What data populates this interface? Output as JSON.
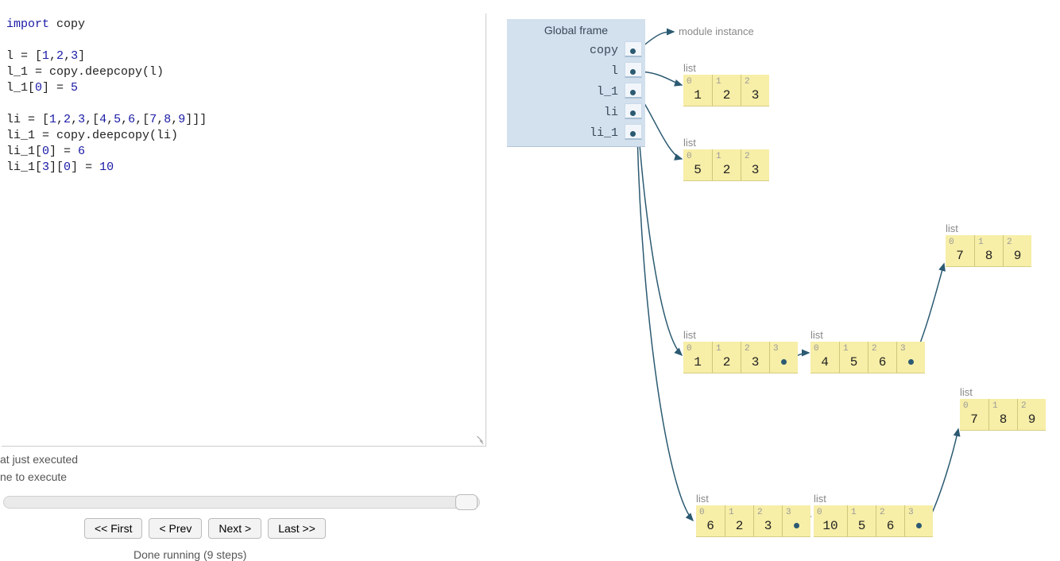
{
  "status": {
    "line1": "at just executed",
    "line2": "ne to execute"
  },
  "buttons": {
    "first": "<< First",
    "prev": "< Prev",
    "next": "Next >",
    "last": "Last >>"
  },
  "done_label": "Done running (9 steps)",
  "code_tokens": [
    {
      "t": "import",
      "c": "kw"
    },
    {
      "t": " copy\n\n",
      "c": ""
    },
    {
      "t": "l = [",
      "c": ""
    },
    {
      "t": "1",
      "c": "num"
    },
    {
      "t": ",",
      "c": ""
    },
    {
      "t": "2",
      "c": "num"
    },
    {
      "t": ",",
      "c": ""
    },
    {
      "t": "3",
      "c": "num"
    },
    {
      "t": "]\n",
      "c": ""
    },
    {
      "t": "l_1 = copy.deepcopy(l)\n",
      "c": ""
    },
    {
      "t": "l_1[",
      "c": ""
    },
    {
      "t": "0",
      "c": "num"
    },
    {
      "t": "] = ",
      "c": ""
    },
    {
      "t": "5",
      "c": "num"
    },
    {
      "t": "\n\n",
      "c": ""
    },
    {
      "t": "li = [",
      "c": ""
    },
    {
      "t": "1",
      "c": "num"
    },
    {
      "t": ",",
      "c": ""
    },
    {
      "t": "2",
      "c": "num"
    },
    {
      "t": ",",
      "c": ""
    },
    {
      "t": "3",
      "c": "num"
    },
    {
      "t": ",[",
      "c": ""
    },
    {
      "t": "4",
      "c": "num"
    },
    {
      "t": ",",
      "c": ""
    },
    {
      "t": "5",
      "c": "num"
    },
    {
      "t": ",",
      "c": ""
    },
    {
      "t": "6",
      "c": "num"
    },
    {
      "t": ",[",
      "c": ""
    },
    {
      "t": "7",
      "c": "num"
    },
    {
      "t": ",",
      "c": ""
    },
    {
      "t": "8",
      "c": "num"
    },
    {
      "t": ",",
      "c": ""
    },
    {
      "t": "9",
      "c": "num"
    },
    {
      "t": "]]]\n",
      "c": ""
    },
    {
      "t": "li_1 = copy.deepcopy(li)\n",
      "c": ""
    },
    {
      "t": "li_1[",
      "c": ""
    },
    {
      "t": "0",
      "c": "num"
    },
    {
      "t": "] = ",
      "c": ""
    },
    {
      "t": "6",
      "c": "num"
    },
    {
      "t": "\n",
      "c": ""
    },
    {
      "t": "li_1[",
      "c": ""
    },
    {
      "t": "3",
      "c": "num"
    },
    {
      "t": "][",
      "c": ""
    },
    {
      "t": "0",
      "c": "num"
    },
    {
      "t": "] = ",
      "c": ""
    },
    {
      "t": "10",
      "c": "num"
    },
    {
      "t": "\n",
      "c": ""
    }
  ],
  "frame": {
    "title": "Global frame",
    "vars": [
      "copy",
      "l",
      "l_1",
      "li",
      "li_1"
    ]
  },
  "module_label": "module instance",
  "lists": {
    "list_l": {
      "label": "list",
      "idx": [
        "0",
        "1",
        "2"
      ],
      "val": [
        "1",
        "2",
        "3"
      ]
    },
    "list_l1": {
      "label": "list",
      "idx": [
        "0",
        "1",
        "2"
      ],
      "val": [
        "5",
        "2",
        "3"
      ]
    },
    "list_li_a": {
      "label": "list",
      "idx": [
        "0",
        "1",
        "2",
        "3"
      ],
      "val": [
        "1",
        "2",
        "3",
        "·"
      ]
    },
    "list_li_b": {
      "label": "list",
      "idx": [
        "0",
        "1",
        "2",
        "3"
      ],
      "val": [
        "4",
        "5",
        "6",
        "·"
      ]
    },
    "list_li_c": {
      "label": "list",
      "idx": [
        "0",
        "1",
        "2"
      ],
      "val": [
        "7",
        "8",
        "9"
      ]
    },
    "list_li1_a": {
      "label": "list",
      "idx": [
        "0",
        "1",
        "2",
        "3"
      ],
      "val": [
        "6",
        "2",
        "3",
        "·"
      ]
    },
    "list_li1_b": {
      "label": "list",
      "idx": [
        "0",
        "1",
        "2",
        "3"
      ],
      "val": [
        "10",
        "5",
        "6",
        "·"
      ]
    },
    "list_li1_c": {
      "label": "list",
      "idx": [
        "0",
        "1",
        "2"
      ],
      "val": [
        "7",
        "8",
        "9"
      ]
    }
  }
}
